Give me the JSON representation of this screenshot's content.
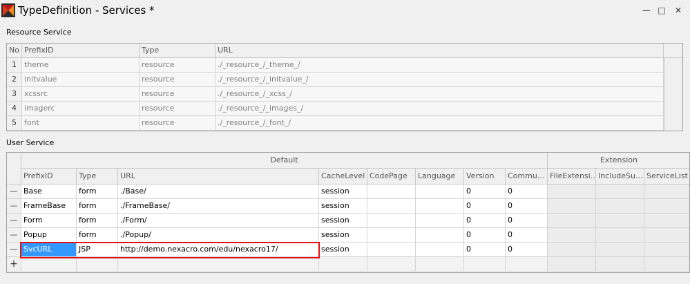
{
  "window": {
    "title": "TypeDefinition - Services *",
    "minimize_glyph": "—",
    "maximize_glyph": "□",
    "close_glyph": "✕"
  },
  "resource_service": {
    "label": "Resource Service",
    "columns": [
      "No",
      "PrefixID",
      "Type",
      "URL"
    ],
    "rows": [
      [
        "1",
        "theme",
        "resource",
        "./_resource_/_theme_/"
      ],
      [
        "2",
        "initvalue",
        "resource",
        "./_resource_/_initvalue_/"
      ],
      [
        "3",
        "xcssrc",
        "resource",
        "./_resource_/_xcss_/"
      ],
      [
        "4",
        "imagerc",
        "resource",
        "./_resource_/_images_/"
      ],
      [
        "5",
        "font",
        "resource",
        "./_resource_/_font_/"
      ]
    ]
  },
  "user_service": {
    "label": "User Service",
    "group_default": "Default",
    "group_extension": "Extension",
    "columns": [
      "PrefixID",
      "Type",
      "URL",
      "CacheLevel",
      "CodePage",
      "Language",
      "Version",
      "Commu...",
      "FileExtensi...",
      "IncludeSu...",
      "ServiceList"
    ],
    "row_glyph": "—",
    "add_glyph": "+",
    "rows": [
      [
        "Base",
        "form",
        "./Base/",
        "session",
        "",
        "",
        "0",
        "0",
        "",
        "",
        ""
      ],
      [
        "FrameBase",
        "form",
        "./FrameBase/",
        "session",
        "",
        "",
        "0",
        "0",
        "",
        "",
        ""
      ],
      [
        "Form",
        "form",
        "./Form/",
        "session",
        "",
        "",
        "0",
        "0",
        "",
        "",
        ""
      ],
      [
        "Popup",
        "form",
        "./Popup/",
        "session",
        "",
        "",
        "0",
        "0",
        "",
        "",
        ""
      ],
      [
        "SvcURL",
        "JSP",
        "http://demo.nexacro.com/edu/nexacro17/",
        "session",
        "",
        "",
        "0",
        "0",
        "",
        "",
        ""
      ]
    ]
  },
  "colors": {
    "selection": "#3399ff",
    "highlight_border": "#e01010"
  }
}
